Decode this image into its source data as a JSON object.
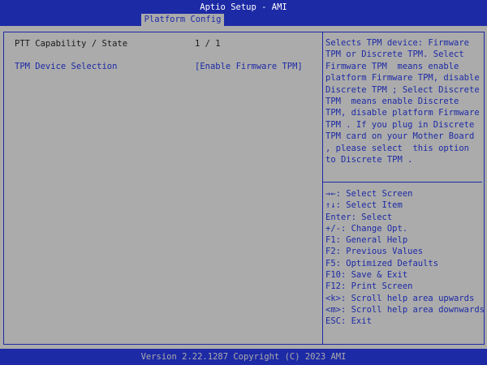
{
  "header": {
    "title": "Aptio Setup - AMI",
    "active_tab": "Platform Config"
  },
  "settings": [
    {
      "label": "PTT Capability / State",
      "value": "1 / 1"
    },
    {
      "label": "TPM Device Selection",
      "value": "[Enable Firmware TPM]"
    }
  ],
  "help": {
    "lines": [
      "Selects TPM device: Firmware",
      "TPM or Discrete TPM. Select",
      "Firmware TPM  means enable",
      "platform Firmware TPM, disable",
      "Discrete TPM ; Select Discrete",
      "TPM  means enable Discrete",
      "TPM, disable platform Firmware",
      "TPM . If you plug in Discrete",
      "TPM card on your Mother Board",
      ", please select  this option",
      "to Discrete TPM ."
    ]
  },
  "keys": [
    "→←: Select Screen",
    "↑↓: Select Item",
    "Enter: Select",
    "+/-: Change Opt.",
    "F1: General Help",
    "F2: Previous Values",
    "F5: Optimized Defaults",
    "F10: Save & Exit",
    "F12: Print Screen",
    "<k>: Scroll help area upwards",
    "<m>: Scroll help area downwards",
    "ESC: Exit"
  ],
  "footer": {
    "text": "Version 2.22.1287 Copyright (C) 2023 AMI"
  },
  "colors": {
    "bios_blue": "#1d2aa5",
    "bios_gray": "#ababab",
    "selected_text": "#1d2aa5",
    "static_text": "#1a1a1a"
  }
}
